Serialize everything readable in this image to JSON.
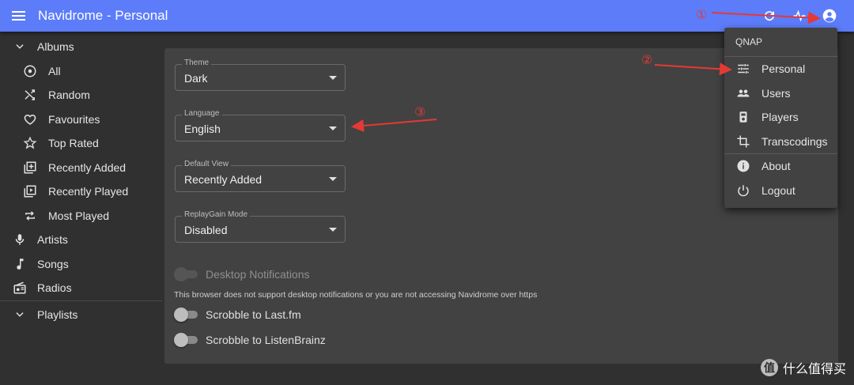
{
  "appbar": {
    "title": "Navidrome - Personal",
    "accent": "#5c7cfa"
  },
  "sidebar": {
    "albums_label": "Albums",
    "album_items": [
      {
        "label": "All",
        "icon": "album-disc-icon"
      },
      {
        "label": "Random",
        "icon": "shuffle-icon"
      },
      {
        "label": "Favourites",
        "icon": "heart-icon"
      },
      {
        "label": "Top Rated",
        "icon": "star-icon"
      },
      {
        "label": "Recently Added",
        "icon": "library-add-icon"
      },
      {
        "label": "Recently Played",
        "icon": "library-play-icon"
      },
      {
        "label": "Most Played",
        "icon": "repeat-icon"
      }
    ],
    "artists_label": "Artists",
    "songs_label": "Songs",
    "radios_label": "Radios",
    "playlists_label": "Playlists"
  },
  "settings": {
    "theme": {
      "label": "Theme",
      "value": "Dark"
    },
    "language": {
      "label": "Language",
      "value": "English"
    },
    "default_view": {
      "label": "Default View",
      "value": "Recently Added"
    },
    "replaygain": {
      "label": "ReplayGain Mode",
      "value": "Disabled"
    },
    "desktop_notifications": "Desktop Notifications",
    "notifications_note": "This browser does not support desktop notifications or you are not accessing Navidrome over https",
    "scrobble_lastfm": "Scrobble to Last.fm",
    "scrobble_listenbrainz": "Scrobble to ListenBrainz"
  },
  "user_menu": {
    "header": "QNAP",
    "items": [
      {
        "label": "Personal",
        "icon": "tune-icon"
      },
      {
        "label": "Users",
        "icon": "people-icon"
      },
      {
        "label": "Players",
        "icon": "player-icon"
      },
      {
        "label": "Transcodings",
        "icon": "crop-icon"
      },
      {
        "label": "About",
        "icon": "info-icon"
      },
      {
        "label": "Logout",
        "icon": "power-icon"
      }
    ]
  },
  "annotations": {
    "one": "①",
    "two": "②",
    "three": "③",
    "color": "#e53935"
  },
  "watermark": {
    "logo": "值",
    "text": "什么值得买"
  }
}
